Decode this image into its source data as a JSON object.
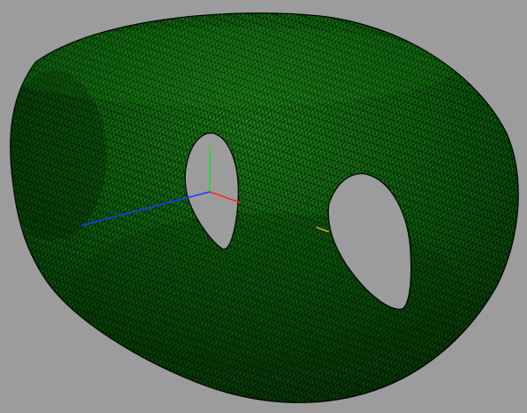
{
  "viewport": {
    "background_color": "#9c9c9c"
  },
  "mesh": {
    "surface_color": "#0d6a0d",
    "surface_light_color": "#1a8a16",
    "surface_shadow_color": "#063a06",
    "edge_color": "#000000",
    "topology": "double-torus",
    "holes": 2,
    "element_type": "triangle"
  },
  "axes_gizmo": {
    "x_axis_color": "#ff2a1a",
    "y_axis_color": "#22dd22",
    "z_axis_color": "#1a3aff",
    "marker_color": "#d6a010"
  }
}
